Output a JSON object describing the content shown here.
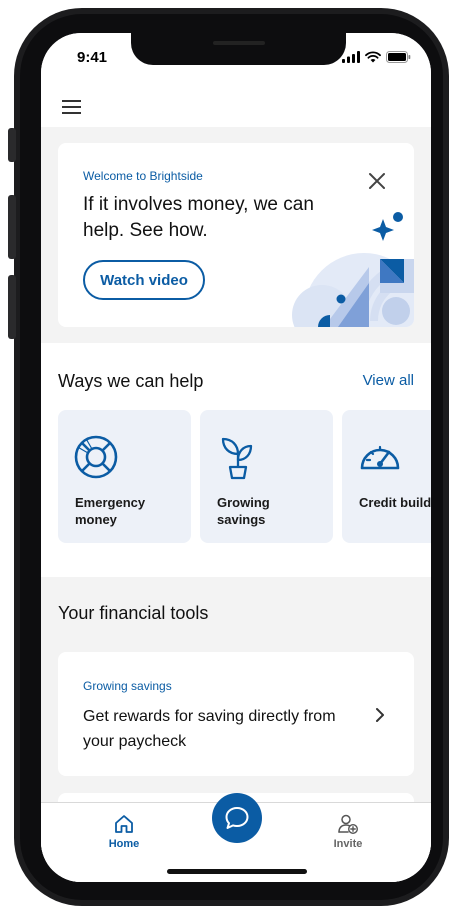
{
  "status_bar": {
    "time": "9:41"
  },
  "welcome": {
    "eyebrow": "Welcome to Brightside",
    "headline": "If it involves money, we can help. See how.",
    "watch_button_label": "Watch video"
  },
  "ways": {
    "title": "Ways we can help",
    "view_all": "View all",
    "tiles": [
      {
        "label": "Emergency money",
        "icon": "lifebuoy-icon"
      },
      {
        "label": "Growing savings",
        "icon": "plant-icon"
      },
      {
        "label": "Credit building",
        "icon": "speedometer-icon"
      }
    ]
  },
  "tools": {
    "title": "Your financial tools",
    "card": {
      "eyebrow": "Growing savings",
      "headline": "Get rewards for saving directly from your paycheck"
    }
  },
  "tab_bar": {
    "home_label": "Home",
    "invite_label": "Invite"
  },
  "colors": {
    "accent": "#0b5ca4",
    "tile_bg": "#edf1f8",
    "section_bg": "#f3f3f3"
  }
}
